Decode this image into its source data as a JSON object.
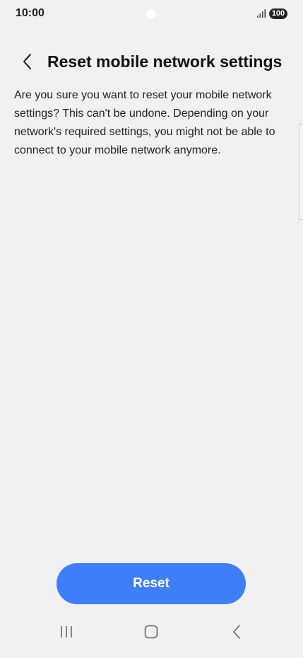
{
  "status_bar": {
    "time": "10:00",
    "battery": "100",
    "signal_icon": "signal-bars-icon"
  },
  "header": {
    "title": "Reset mobile network settings",
    "back_icon": "chevron-left-icon"
  },
  "content": {
    "description": "Are you sure you want to reset your mobile network settings? This can't be undone. Depending on your network's required settings, you might not be able to connect to your mobile network anymore."
  },
  "actions": {
    "reset_label": "Reset",
    "accent_color": "#3e7ef9"
  },
  "nav_bar": {
    "recents_icon": "recents-icon",
    "home_icon": "home-icon",
    "back_icon": "back-icon"
  }
}
